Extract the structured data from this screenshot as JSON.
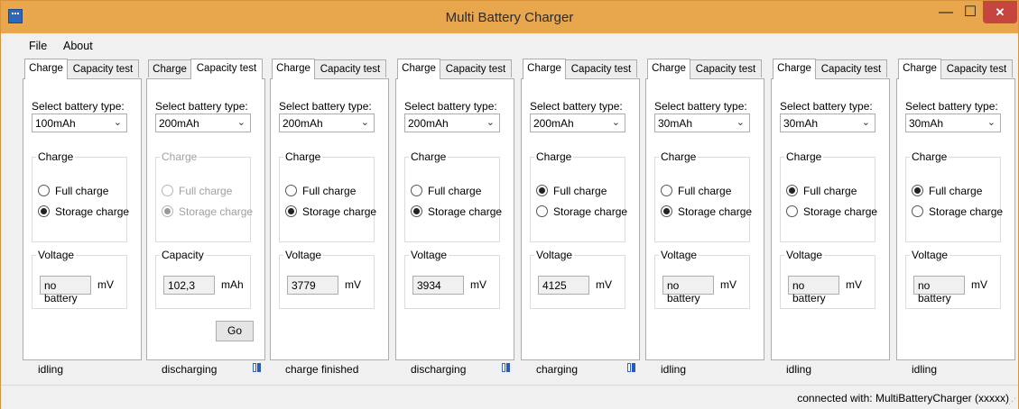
{
  "window": {
    "title": "Multi Battery Charger",
    "minimize": "—",
    "maximize": "☐",
    "close": "✕"
  },
  "menu": {
    "file": "File",
    "about": "About"
  },
  "labels": {
    "tab_charge": "Charge",
    "tab_capacity": "Capacity test",
    "select_battery": "Select battery type:",
    "charge_group": "Charge",
    "full_charge": "Full charge",
    "storage_charge": "Storage charge",
    "voltage": "Voltage",
    "capacity": "Capacity",
    "go": "Go"
  },
  "panels": [
    {
      "tab": "charge",
      "battery_type": "100mAh",
      "charge_mode": "storage",
      "measure": "voltage",
      "value": "no battery",
      "unit": "mV",
      "status": "idling",
      "activity_icon": false,
      "disabled": false
    },
    {
      "tab": "capacity",
      "battery_type": "200mAh",
      "charge_mode": "storage",
      "measure": "capacity",
      "value": "102,3",
      "unit": "mAh",
      "status": "discharging",
      "activity_icon": true,
      "disabled": true
    },
    {
      "tab": "charge",
      "battery_type": "200mAh",
      "charge_mode": "storage",
      "measure": "voltage",
      "value": "3779",
      "unit": "mV",
      "status": "charge finished",
      "activity_icon": false,
      "disabled": false
    },
    {
      "tab": "charge",
      "battery_type": "200mAh",
      "charge_mode": "storage",
      "measure": "voltage",
      "value": "3934",
      "unit": "mV",
      "status": "discharging",
      "activity_icon": true,
      "disabled": false
    },
    {
      "tab": "charge",
      "battery_type": "200mAh",
      "charge_mode": "full",
      "measure": "voltage",
      "value": "4125",
      "unit": "mV",
      "status": "charging",
      "activity_icon": true,
      "disabled": false
    },
    {
      "tab": "charge",
      "battery_type": "30mAh",
      "charge_mode": "storage",
      "measure": "voltage",
      "value": "no battery",
      "unit": "mV",
      "status": "idling",
      "activity_icon": false,
      "disabled": false
    },
    {
      "tab": "charge",
      "battery_type": "30mAh",
      "charge_mode": "full",
      "measure": "voltage",
      "value": "no battery",
      "unit": "mV",
      "status": "idling",
      "activity_icon": false,
      "disabled": false
    },
    {
      "tab": "charge",
      "battery_type": "30mAh",
      "charge_mode": "full",
      "measure": "voltage",
      "value": "no battery",
      "unit": "mV",
      "status": "idling",
      "activity_icon": false,
      "disabled": false
    }
  ],
  "statusbar": {
    "connection": "connected with: MultiBatteryCharger (xxxxx)"
  },
  "colors": {
    "titlebar": "#e8a64d",
    "close_button": "#c7453f",
    "activity_icon": "#2b59c3"
  }
}
